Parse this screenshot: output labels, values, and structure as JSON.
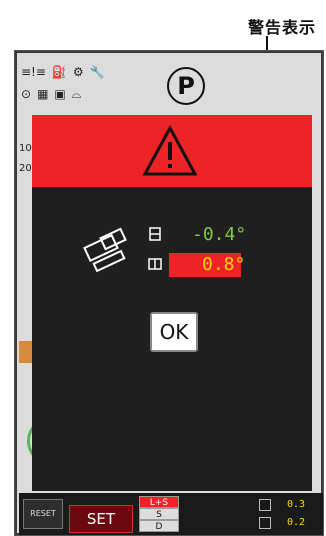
{
  "callout": {
    "label": "警告表示"
  },
  "status_bar": {
    "row1_icons": [
      "warning-small-icon",
      "oil-icon",
      "gear-icon",
      "wrench-icon"
    ],
    "row2_icons": [
      "engine-icon",
      "filter-icon",
      "battery-icon",
      "turtle-icon"
    ],
    "parking_letter": "P"
  },
  "background": {
    "left_text_1": "10",
    "left_text_2": "20"
  },
  "dialog": {
    "header_color": "#ee2327",
    "warning_icon": "warning-triangle-icon",
    "tilt_icon": "machine-tilt-icon",
    "front_back_value": "-0.4°",
    "left_right_value": "0.8°",
    "ok_label": "OK"
  },
  "bottom_bar": {
    "reset_label": "RESET",
    "set_label": "SET",
    "modes": [
      "L+S",
      "S",
      "D"
    ],
    "value_1": "0.3",
    "value_2": "0.2"
  },
  "colors": {
    "alert_red": "#ee2327",
    "value_green": "#7ccb3b",
    "value_yellow": "#ffd700"
  }
}
